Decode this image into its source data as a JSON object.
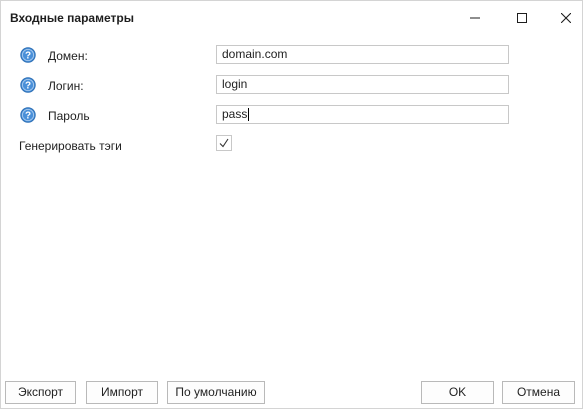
{
  "window": {
    "title": "Входные параметры",
    "controls": {
      "minimize_icon": "minimize-icon",
      "maximize_icon": "maximize-icon",
      "close_icon": "close-icon"
    }
  },
  "fields": [
    {
      "label": "Домен:",
      "value": "domain.com",
      "help_icon": "help-icon"
    },
    {
      "label": "Логин:",
      "value": "login",
      "help_icon": "help-icon"
    },
    {
      "label": "Пароль",
      "value": "pass",
      "help_icon": "help-icon"
    }
  ],
  "generate_tags": {
    "label": "Генерировать тэги",
    "checked": true
  },
  "buttons": {
    "export": "Экспорт",
    "import": "Импорт",
    "defaults": "По умолчанию",
    "ok": "OK",
    "cancel": "Отмена"
  },
  "colors": {
    "help_icon_fill": "#4a90d9",
    "help_icon_border": "#2d6fb5"
  }
}
